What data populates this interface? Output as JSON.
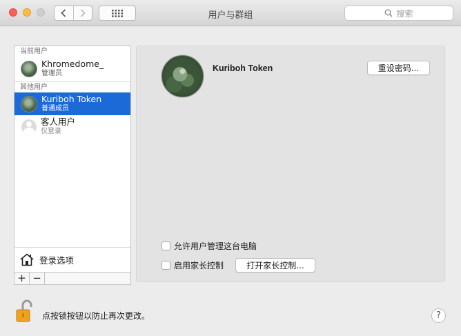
{
  "window": {
    "title": "用户与群组"
  },
  "search": {
    "placeholder": "搜索"
  },
  "sidebar": {
    "current_section": "当前用户",
    "current_user": {
      "name": "Khromedome_",
      "role": "管理员"
    },
    "other_section": "其他用户",
    "other_users": [
      {
        "name": "Kuriboh Token",
        "role": "普通成员",
        "selected": true
      },
      {
        "name": "客人用户",
        "role": "仅登录",
        "selected": false
      }
    ],
    "login_options": "登录选项",
    "add_label": "+",
    "remove_label": "−"
  },
  "detail": {
    "account_name": "Kuriboh Token",
    "reset_password": "重设密码...",
    "allow_admin": "允许用户管理这台电脑",
    "enable_parental": "启用家长控制",
    "open_parental": "打开家长控制..."
  },
  "footer": {
    "lock_text": "点按锁按钮以防止再次更改。",
    "help": "?"
  },
  "colors": {
    "selection": "#1b6ad8",
    "lock": "#f0a21f"
  },
  "icons": {
    "back": "chevron-left-icon",
    "forward": "chevron-right-icon",
    "grid": "grid-icon",
    "search": "search-icon",
    "home": "house-icon",
    "lock": "lock-icon"
  }
}
